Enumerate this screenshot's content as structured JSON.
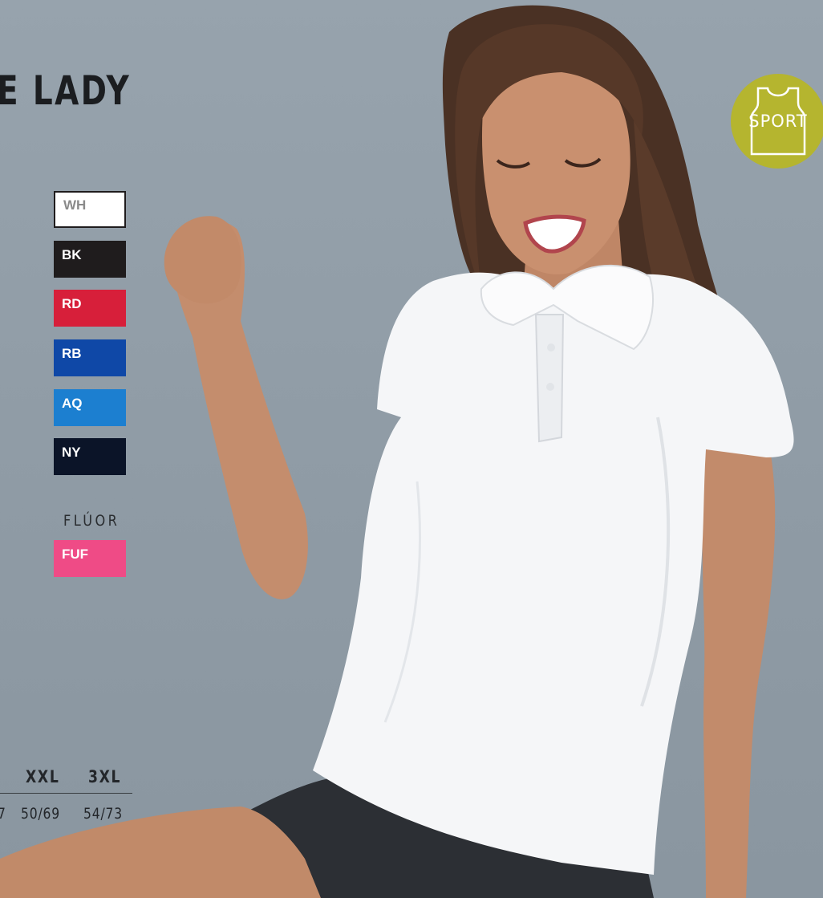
{
  "header": {
    "title": "E LADY"
  },
  "badge": {
    "label": "SPORT",
    "icon": "tank-top-icon",
    "color": "#b5b52f"
  },
  "colors": [
    {
      "code": "WH",
      "hex": "#ffffff",
      "text_color": "#8a8a8a"
    },
    {
      "code": "BK",
      "hex": "#1f1c1d",
      "text_color": "#ffffff"
    },
    {
      "code": "RD",
      "hex": "#d71f3a",
      "text_color": "#ffffff"
    },
    {
      "code": "RB",
      "hex": "#0f48a7",
      "text_color": "#ffffff"
    },
    {
      "code": "AQ",
      "hex": "#1c7fd0",
      "text_color": "#ffffff"
    },
    {
      "code": "NY",
      "hex": "#0b1428",
      "text_color": "#ffffff"
    }
  ],
  "fluor": {
    "label": "FLÚOR",
    "code": "FUF",
    "hex": "#ef4b86"
  },
  "sizes": {
    "headers": [
      "XXL",
      "3XL"
    ],
    "values": [
      "7",
      "50/69",
      "54/73"
    ]
  }
}
